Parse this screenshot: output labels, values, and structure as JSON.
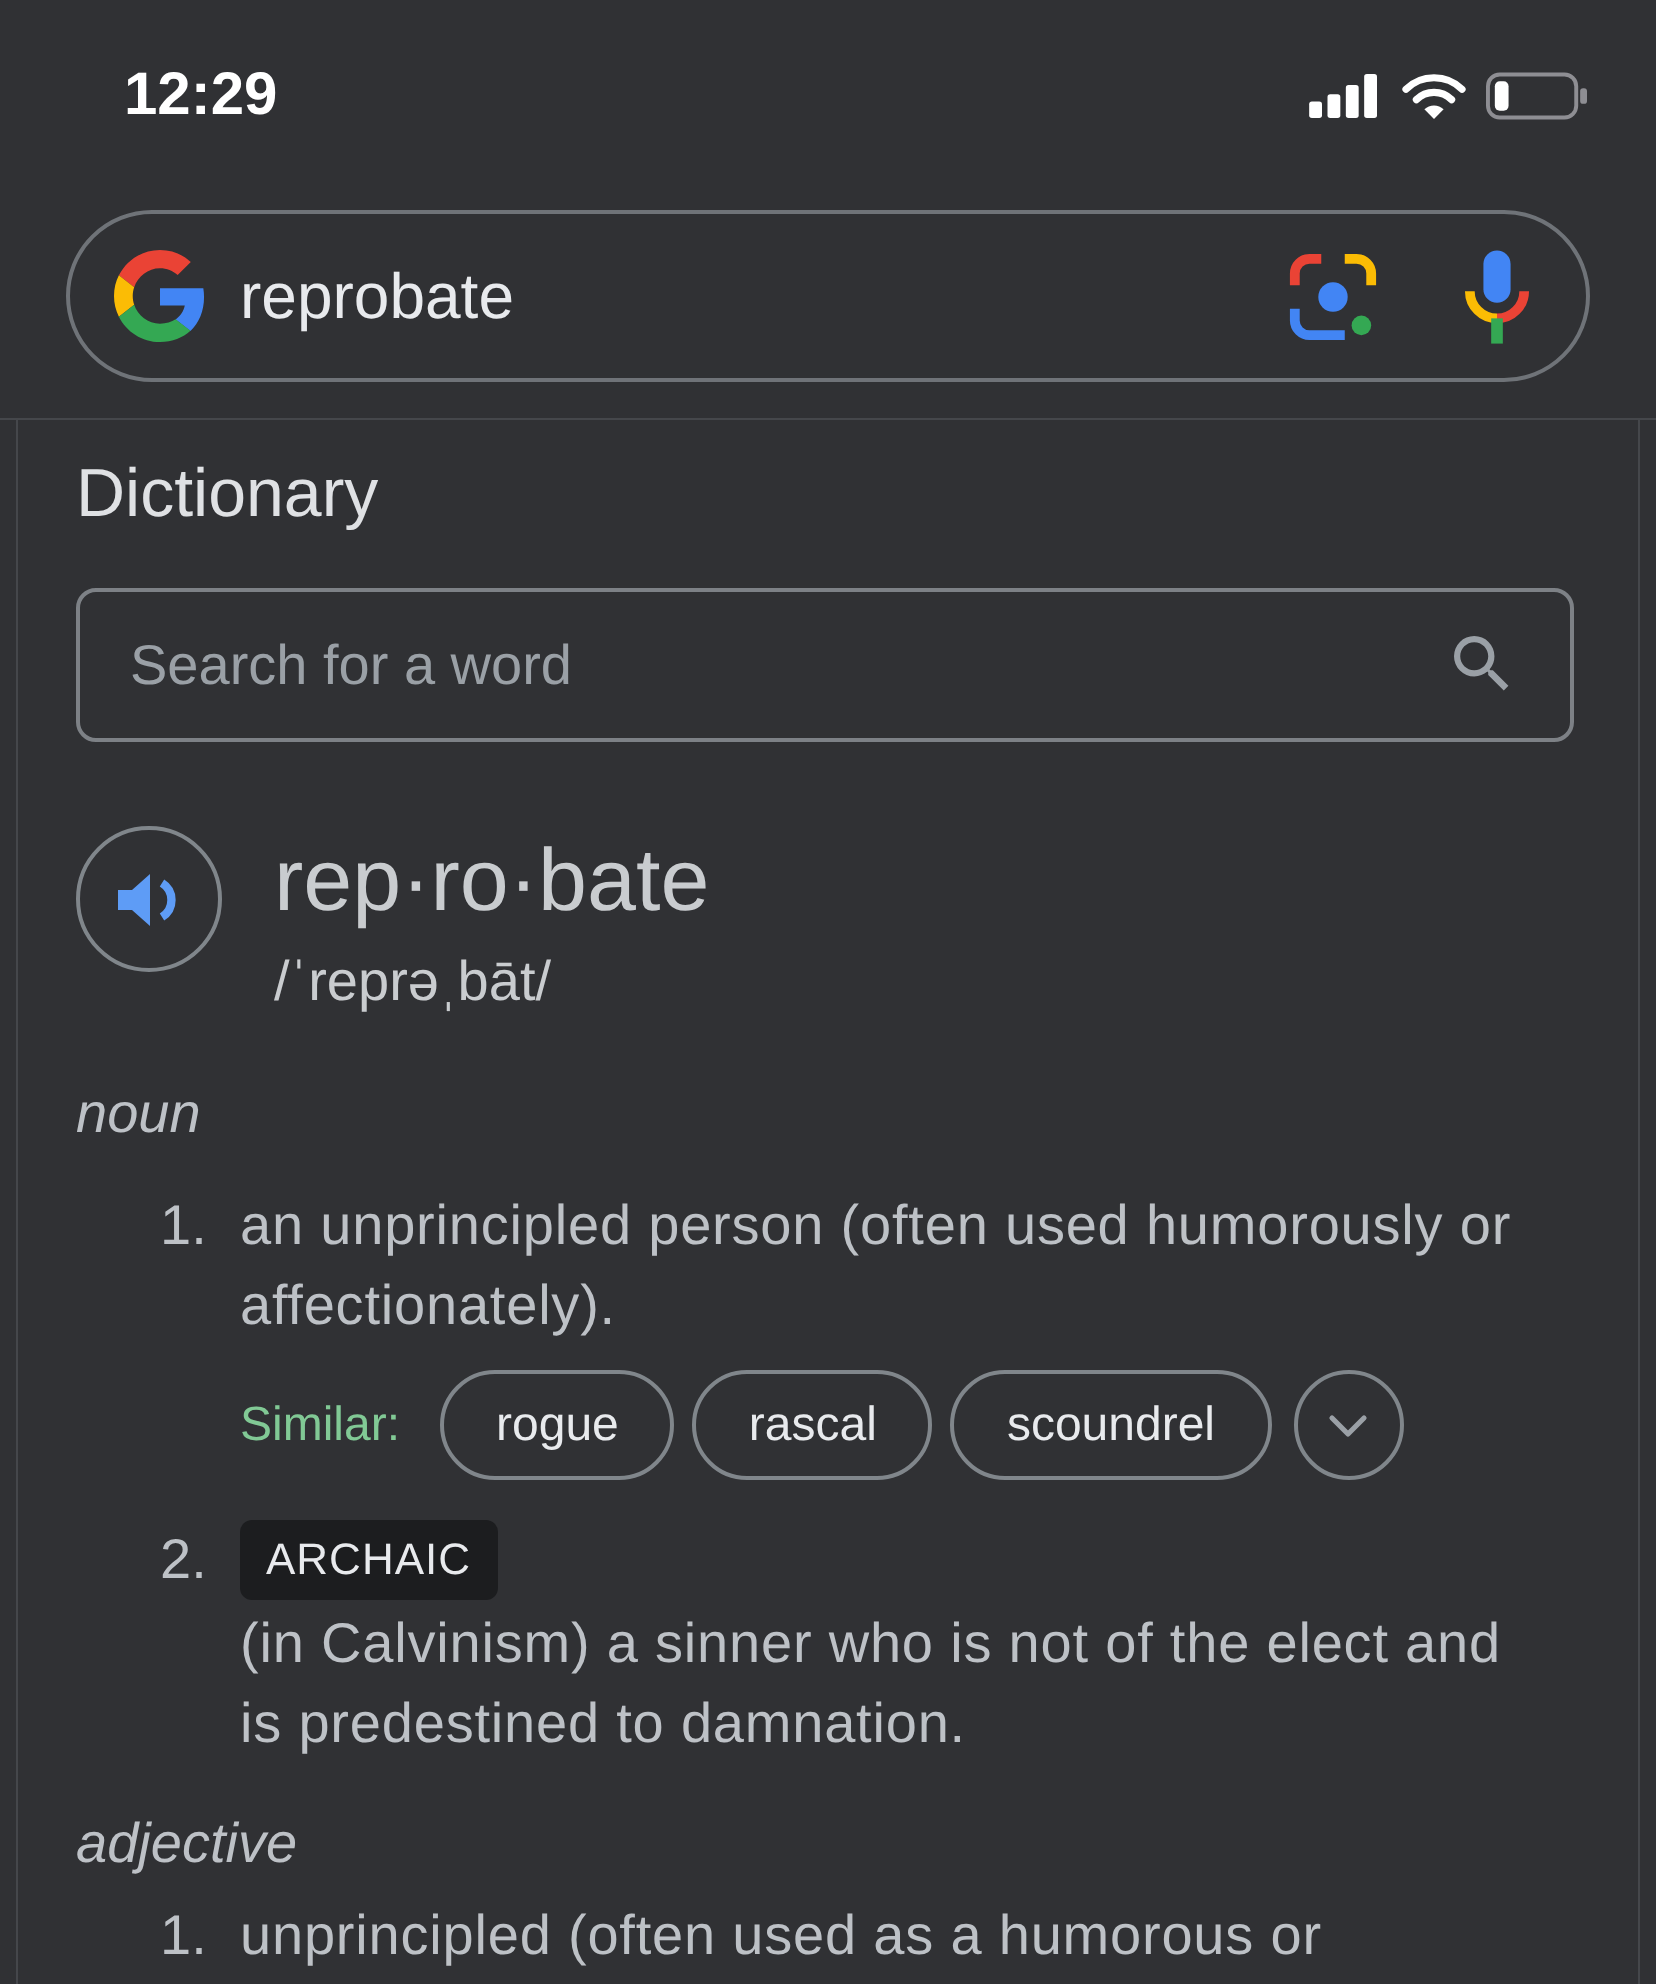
{
  "status_bar": {
    "time": "12:29"
  },
  "search_bar": {
    "query": "reprobate"
  },
  "dictionary": {
    "title": "Dictionary",
    "search": {
      "placeholder": "Search for a word"
    },
    "entry": {
      "word": "rep·ro·bate",
      "phonetic": "/ˈreprəˌbāt/"
    },
    "senses": [
      {
        "part_of_speech": "noun",
        "definitions": [
          {
            "number": "1.",
            "text": "an unprincipled person (often used humorously or affectionately).",
            "similar_label": "Similar:",
            "similar": [
              "rogue",
              "rascal",
              "scoundrel"
            ]
          },
          {
            "number": "2.",
            "tag": "ARCHAIC",
            "text": "(in Calvinism) a sinner who is not of the elect and is predestined to damnation."
          }
        ]
      },
      {
        "part_of_speech": "adjective",
        "definitions": [
          {
            "number": "1.",
            "text": "unprincipled (often used as a humorous or"
          }
        ]
      }
    ]
  }
}
